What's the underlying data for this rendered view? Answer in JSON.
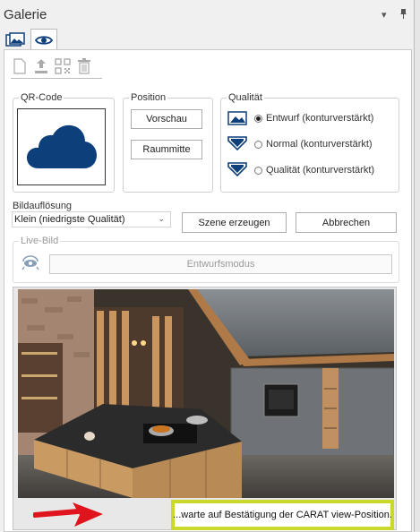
{
  "title": "Galerie",
  "titlebar_icons": {
    "menu": "chevron-down-icon",
    "pin": "pin-icon"
  },
  "tabs": [
    {
      "icon": "gallery-images-icon",
      "active": false
    },
    {
      "icon": "eye-icon",
      "active": true
    }
  ],
  "toolbar": [
    {
      "icon": "new-document-icon"
    },
    {
      "icon": "upload-icon"
    },
    {
      "icon": "qr-code-icon"
    },
    {
      "icon": "trash-icon"
    }
  ],
  "qr_group": {
    "legend": "QR-Code",
    "icon": "cloud-icon",
    "cloud_color": "#0d3f7a"
  },
  "position_group": {
    "legend": "Position",
    "buttons": [
      "Vorschau",
      "Raummitte"
    ]
  },
  "quality_group": {
    "legend": "Qualität",
    "options": [
      {
        "label": "Entwurf (konturverstärkt)",
        "selected": true,
        "icon": "landscape-image-icon"
      },
      {
        "label": "Normal (konturverstärkt)",
        "selected": false,
        "icon": "quality-shield-icon"
      },
      {
        "label": "Qualität (konturverstärkt)",
        "selected": false,
        "icon": "quality-shield-icon"
      }
    ]
  },
  "resolution": {
    "label": "Bildauflösung",
    "selected": "Klein (niedrigste Qualität)"
  },
  "actions": {
    "generate": "Szene erzeugen",
    "cancel": "Abbrechen"
  },
  "live_image": {
    "legend": "Live-Bild",
    "mode_button": "Entwurfsmodus",
    "icon": "live-camera-icon"
  },
  "preview": {
    "icon": "kitchen-render-image",
    "arrow_icon": "red-arrow-icon"
  },
  "status_text": "...warte auf Bestätigung der CARAT view-Position.",
  "colors": {
    "accent_blue": "#0d3f7a",
    "status_border": "#c9d82b",
    "arrow_red": "#e0141c"
  }
}
